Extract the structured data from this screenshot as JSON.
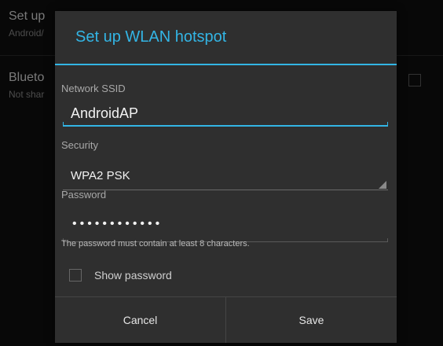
{
  "background": {
    "items": [
      {
        "title": "Set up",
        "subtitle": "Android/"
      },
      {
        "title": "Blueto",
        "subtitle": "Not shar"
      }
    ]
  },
  "dialog": {
    "title": "Set up WLAN hotspot",
    "ssid": {
      "label": "Network SSID",
      "value": "AndroidAP"
    },
    "security": {
      "label": "Security",
      "value": "WPA2 PSK"
    },
    "password": {
      "label": "Password",
      "masked_value": "••••••••••••",
      "hint": "The password must contain at least 8 characters."
    },
    "show_password": {
      "label": "Show password",
      "checked": false
    },
    "buttons": {
      "cancel": "Cancel",
      "save": "Save"
    }
  },
  "colors": {
    "accent": "#33b5e5",
    "dialog_bg": "#2f2f2f",
    "background": "#101010"
  },
  "icons": {
    "spinner_arrow": "dropdown-triangle-icon"
  }
}
